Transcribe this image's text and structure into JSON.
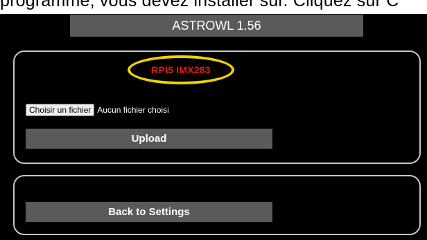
{
  "document_strip": {
    "text": "programme, vous devez installer sur. Cliquez sur C"
  },
  "header": {
    "title": "ASTROWL 1.56"
  },
  "upload_panel": {
    "device_label": "RPI5 IMX283",
    "file_input": {
      "button_label": "Choisir un fichier",
      "status_text": "Aucun fichier choisi"
    },
    "upload_label": "Upload"
  },
  "back_panel": {
    "back_label": "Back to Settings"
  },
  "colors": {
    "background": "#000000",
    "button_gray": "#5a5a5a",
    "device_red": "#e61919",
    "highlight_yellow": "#f0d200",
    "panel_border": "#c8c8c8"
  }
}
